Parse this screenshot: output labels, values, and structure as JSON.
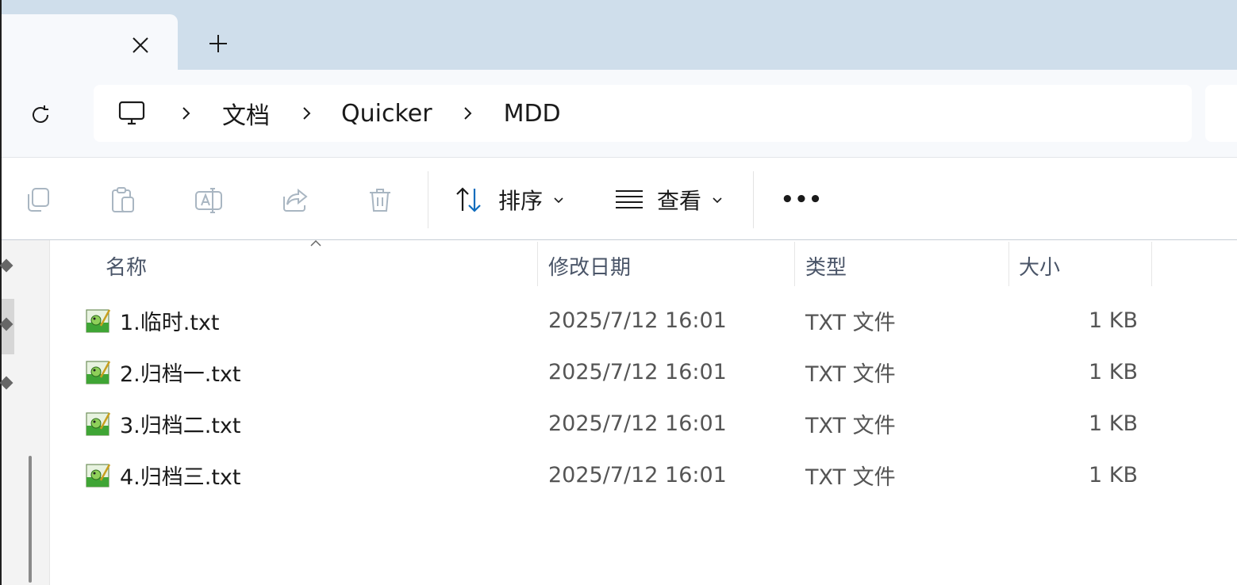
{
  "window": {
    "tab_close_icon": "close-icon",
    "new_tab_icon": "plus-icon"
  },
  "navigation": {
    "refresh_icon": "refresh-icon",
    "breadcrumb": {
      "root_icon": "this-pc-icon",
      "separator_icon": "chevron-right-icon",
      "items": [
        "文档",
        "Quicker",
        "MDD"
      ]
    }
  },
  "toolbar": {
    "icons": [
      "copy-icon",
      "paste-icon",
      "rename-icon",
      "share-icon",
      "delete-icon"
    ],
    "sort_label": "排序",
    "view_label": "查看",
    "more_label": "•••"
  },
  "file_list": {
    "columns": [
      "名称",
      "修改日期",
      "类型",
      "大小"
    ],
    "sort_indicator_icon": "sort-up-icon",
    "rows": [
      {
        "name": "1.临时.txt",
        "modified": "2025/7/12 16:01",
        "type": "TXT 文件",
        "size": "1 KB",
        "icon": "notepad-file-icon"
      },
      {
        "name": "2.归档一.txt",
        "modified": "2025/7/12 16:01",
        "type": "TXT 文件",
        "size": "1 KB",
        "icon": "notepad-file-icon"
      },
      {
        "name": "3.归档二.txt",
        "modified": "2025/7/12 16:01",
        "type": "TXT 文件",
        "size": "1 KB",
        "icon": "notepad-file-icon"
      },
      {
        "name": "4.归档三.txt",
        "modified": "2025/7/12 16:01",
        "type": "TXT 文件",
        "size": "1 KB",
        "icon": "notepad-file-icon"
      }
    ]
  },
  "colors": {
    "titlebar": "#cfdeeb",
    "accent": "#0f6cbd"
  }
}
